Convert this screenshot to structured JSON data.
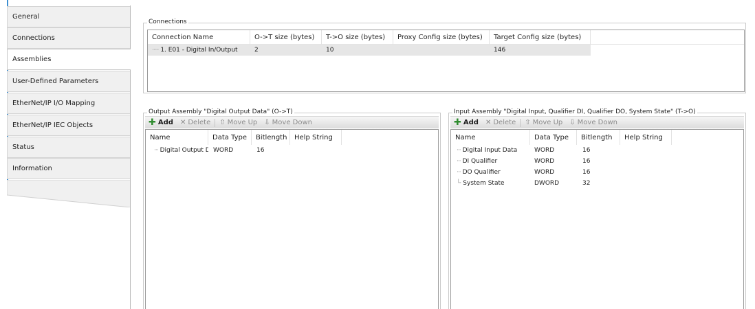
{
  "tabs": [
    {
      "label": "General"
    },
    {
      "label": "Connections"
    },
    {
      "label": "Assemblies"
    },
    {
      "label": "User-Defined Parameters"
    },
    {
      "label": "EtherNet/IP I/O Mapping"
    },
    {
      "label": "EtherNet/IP IEC Objects"
    },
    {
      "label": "Status"
    },
    {
      "label": "Information"
    }
  ],
  "active_tab": "Assemblies",
  "connections": {
    "title": "Connections",
    "columns": [
      "Connection Name",
      "O->T size (bytes)",
      "T->O size (bytes)",
      "Proxy Config size (bytes)",
      "Target Config size (bytes)"
    ],
    "rows": [
      {
        "name": "1. E01 - Digital In/Output",
        "ot": "2",
        "to": "10",
        "proxy": "",
        "target": "146"
      }
    ]
  },
  "output_assembly": {
    "title": "Output Assembly \"Digital Output Data\" (O->T)",
    "toolbar": {
      "add": "Add",
      "delete": "Delete",
      "move_up": "Move Up",
      "move_down": "Move Down"
    },
    "columns": [
      "Name",
      "Data Type",
      "Bitlength",
      "Help String"
    ],
    "rows": [
      {
        "name": "Digital Output Data",
        "type": "WORD",
        "bits": "16",
        "help": ""
      }
    ]
  },
  "input_assembly": {
    "title": "Input Assembly \"Digital Input, Qualifier DI, Qualifier DO, System State\" (T->O)",
    "toolbar": {
      "add": "Add",
      "delete": "Delete",
      "move_up": "Move Up",
      "move_down": "Move Down"
    },
    "columns": [
      "Name",
      "Data Type",
      "Bitlength",
      "Help String"
    ],
    "rows": [
      {
        "name": "Digital Input Data",
        "type": "WORD",
        "bits": "16",
        "help": ""
      },
      {
        "name": "DI Qualifier",
        "type": "WORD",
        "bits": "16",
        "help": ""
      },
      {
        "name": "DO Qualifier",
        "type": "WORD",
        "bits": "16",
        "help": ""
      },
      {
        "name": "System State",
        "type": "DWORD",
        "bits": "32",
        "help": ""
      }
    ]
  },
  "icons": {
    "add": "add-icon",
    "delete": "delete-icon",
    "move_up": "arrow-up-icon",
    "move_down": "arrow-down-icon"
  },
  "colors": {
    "tab_accent": "#3d8fd1",
    "add_icon": "#2e8b2e",
    "selected_row": "#e6e6e6"
  }
}
